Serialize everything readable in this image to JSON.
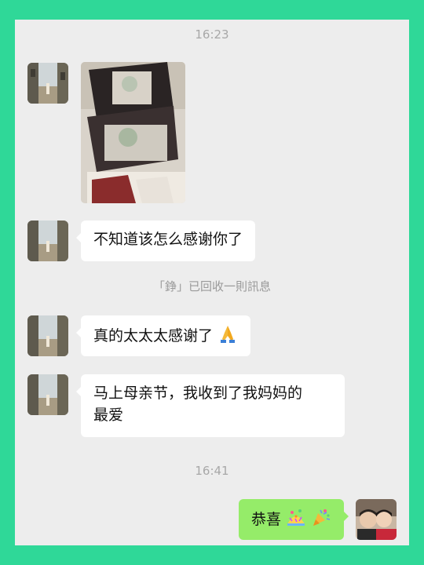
{
  "chat": {
    "timestamp_1": "16:23",
    "message_text_1": "不知道该怎么感谢你了",
    "recalled_notice": "「錚」已回收一則訊息",
    "message_text_2": "真的太太太感谢了",
    "message_text_3_line1": "马上母亲节，我收到了我妈妈的",
    "message_text_3_line2": "最爱",
    "timestamp_2": "16:41",
    "reply_text": "恭喜"
  },
  "icons": {
    "pray": "folded-hands-emoji",
    "confetti": "confetti-ball-emoji",
    "party": "party-popper-emoji"
  },
  "colors": {
    "frame": "#2fd898",
    "background": "#ededed",
    "incoming_bubble": "#ffffff",
    "outgoing_bubble": "#95ec69",
    "timestamp_text": "#a8a8a8"
  }
}
